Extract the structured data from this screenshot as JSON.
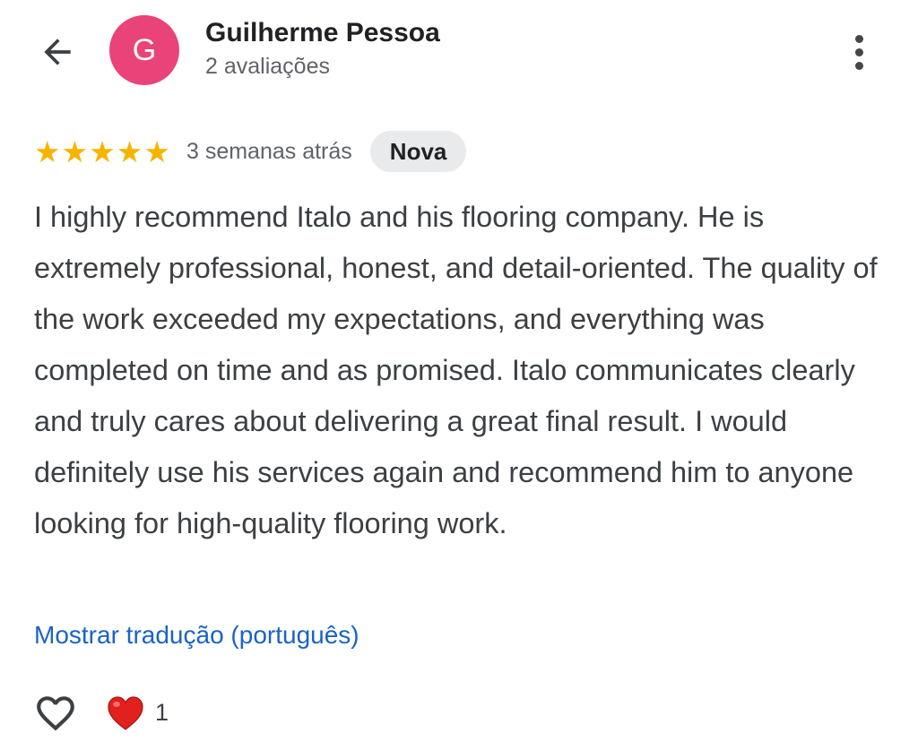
{
  "header": {
    "back_icon": "arrow-back-icon",
    "avatar_letter": "G",
    "avatar_color": "#e9437a",
    "author_name": "Guilherme Pessoa",
    "author_meta": "2 avaliações",
    "more_icon": "more-vert-icon"
  },
  "review": {
    "rating": 5,
    "max_rating": 5,
    "star_color": "#f6b400",
    "time": "3 semanas atrás",
    "badge": "Nova",
    "text": "I highly recommend Italo and his flooring company. He is extremely professional, honest, and detail-oriented. The quality of the work exceeded my expectations, and everything was completed on time and as promised. Italo communicates clearly and truly cares about delivering a great final result. I would definitely use his services again and recommend him to anyone looking for high-quality flooring work.",
    "translate_link": "Mostrar tradução (português)",
    "link_color": "#1a62c9"
  },
  "reactions": {
    "like_icon": "heart-outline-icon",
    "reaction_icon": "red-heart-icon",
    "count": "1"
  }
}
